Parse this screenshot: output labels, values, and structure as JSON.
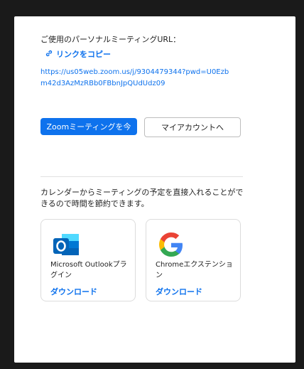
{
  "personal_url_label": "ご使用のパーソナルミーティングURL：",
  "copy_link_label": "リンクをコピー",
  "meeting_url": "https://us05web.zoom.us/j/9304479344?pwd=U0Ezbm42d3AzMzRBb0FBbnJpQUdUdz09",
  "buttons": {
    "start_meeting": "Zoomミーティングを今",
    "my_account": "マイアカウントへ"
  },
  "calendar_text": "カレンダーからミーティングの予定を直接入れることができるので時間を節約できます。",
  "cards": [
    {
      "title": "Microsoft Outlookプラグイン",
      "link": "ダウンロード",
      "icon": "outlook-icon"
    },
    {
      "title": "Chromeエクステンション",
      "link": "ダウンロード",
      "icon": "google-icon"
    }
  ],
  "colors": {
    "accent": "#0e72ed",
    "outlook_blue": "#0364b8",
    "google_blue": "#4285f4",
    "google_red": "#ea4335",
    "google_yellow": "#fbbc05",
    "google_green": "#34a853"
  }
}
